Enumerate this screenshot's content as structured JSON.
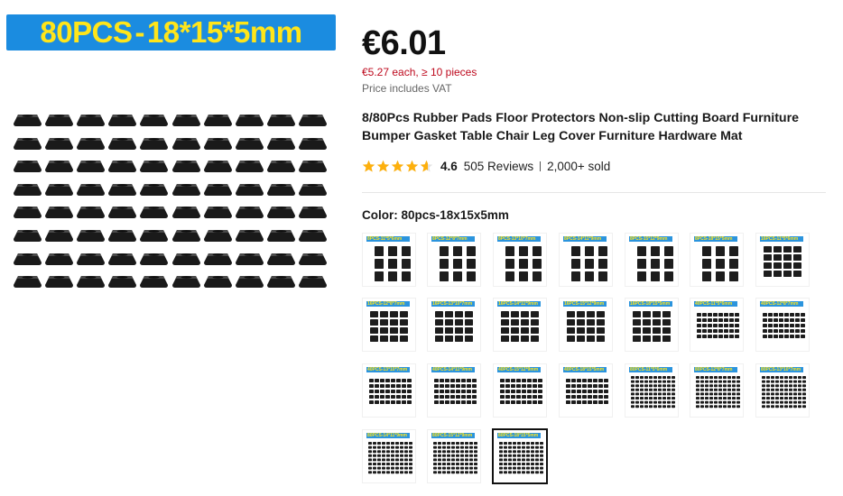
{
  "gallery": {
    "banner": {
      "count": "80PCS",
      "separator": "-",
      "size": "18*15*5mm",
      "bg_color": "#1b8ce0",
      "text_color": "#ffe51a"
    },
    "image_alt_icon": "rubber-pads-grid"
  },
  "product": {
    "price": "€6.01",
    "bulk_price": "€5.27 each, ≥ 10 pieces",
    "vat_note": "Price includes VAT",
    "title": "8/80Pcs Rubber Pads Floor Protectors Non-slip Cutting Board Furniture Bumper Gasket Table Chair Leg Cover Furniture Hardware Mat",
    "rating": {
      "score": "4.6",
      "stars_value": 4.6,
      "reviews": "505 Reviews",
      "sold": "2,000+ sold",
      "star_color": "#fdb00d"
    },
    "color": {
      "label": "Color:",
      "selected": "80pcs-18x15x5mm"
    }
  },
  "swatches": [
    {
      "tag": "8PCS-11*5*6mm",
      "pcs": 8,
      "selected": false
    },
    {
      "tag": "8PCS-12*8*7mm",
      "pcs": 8,
      "selected": false
    },
    {
      "tag": "8PCS-13*10*7mm",
      "pcs": 8,
      "selected": false
    },
    {
      "tag": "8PCS-14*11*9mm",
      "pcs": 8,
      "selected": false
    },
    {
      "tag": "8PCS-15*12*9mm",
      "pcs": 8,
      "selected": false
    },
    {
      "tag": "8PCS-18*15*5mm",
      "pcs": 8,
      "selected": false
    },
    {
      "tag": "16PCS-11*5*6mm",
      "pcs": 16,
      "selected": false
    },
    {
      "tag": "16PCS-12*8*7mm",
      "pcs": 16,
      "selected": false
    },
    {
      "tag": "16PCS-13*10*7mm",
      "pcs": 16,
      "selected": false
    },
    {
      "tag": "16PCS-14*11*9mm",
      "pcs": 16,
      "selected": false
    },
    {
      "tag": "16PCS-15*12*9mm",
      "pcs": 16,
      "selected": false
    },
    {
      "tag": "16PCS-18*15*5mm",
      "pcs": 16,
      "selected": false
    },
    {
      "tag": "40PCS-11*5*6mm",
      "pcs": 40,
      "selected": false
    },
    {
      "tag": "40PCS-12*8*7mm",
      "pcs": 40,
      "selected": false
    },
    {
      "tag": "40PCS-13*10*7mm",
      "pcs": 40,
      "selected": false
    },
    {
      "tag": "40PCS-14*11*9mm",
      "pcs": 40,
      "selected": false
    },
    {
      "tag": "40PCS-15*12*9mm",
      "pcs": 40,
      "selected": false
    },
    {
      "tag": "40PCS-18*15*5mm",
      "pcs": 40,
      "selected": false
    },
    {
      "tag": "80PCS-11*5*6mm",
      "pcs": 80,
      "selected": false
    },
    {
      "tag": "80PCS-12*8*7mm",
      "pcs": 80,
      "selected": false
    },
    {
      "tag": "80PCS-13*10*7mm",
      "pcs": 80,
      "selected": false
    },
    {
      "tag": "80PCS-14*11*9mm",
      "pcs": 80,
      "selected": false
    },
    {
      "tag": "80PCS-15*12*9mm",
      "pcs": 80,
      "selected": false
    },
    {
      "tag": "80PCS-18*15*5mm",
      "pcs": 80,
      "selected": true
    }
  ]
}
